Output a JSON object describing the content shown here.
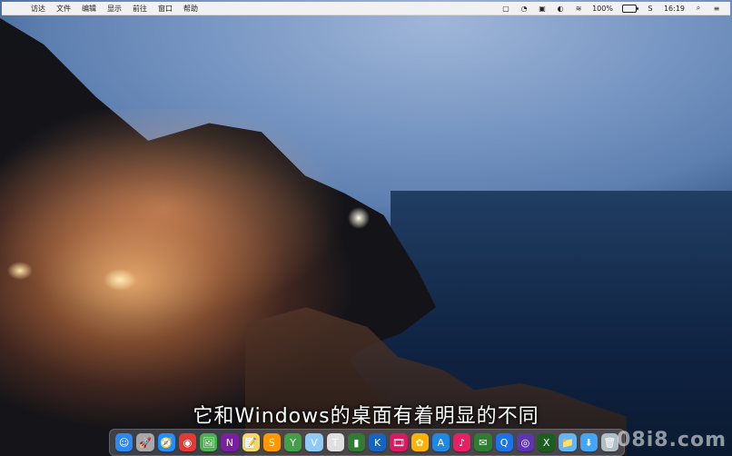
{
  "menubar": {
    "apple": "",
    "items": [
      "访达",
      "文件",
      "编辑",
      "显示",
      "前往",
      "窗口",
      "帮助"
    ],
    "status": {
      "battery": "100%",
      "time": "16:19"
    }
  },
  "subtitle": "它和Windows的桌面有着明显的不同",
  "dock": {
    "items": [
      {
        "name": "finder-icon",
        "color": "#2d89ef",
        "glyph": "☺"
      },
      {
        "name": "launchpad-icon",
        "color": "#a8a8a8",
        "glyph": "🚀"
      },
      {
        "name": "safari-icon",
        "color": "#1e90ff",
        "glyph": "🧭"
      },
      {
        "name": "chrome-icon",
        "color": "#e53935",
        "glyph": "◉"
      },
      {
        "name": "preview-icon",
        "color": "#4caf50",
        "glyph": "🖼"
      },
      {
        "name": "onenote-icon",
        "color": "#7b1fa2",
        "glyph": "N"
      },
      {
        "name": "notes-icon",
        "color": "#f6d860",
        "glyph": "📝"
      },
      {
        "name": "sublime-icon",
        "color": "#ff9800",
        "glyph": "S"
      },
      {
        "name": "y-icon",
        "color": "#43a047",
        "glyph": "Y"
      },
      {
        "name": "vpn-icon",
        "color": "#90caf9",
        "glyph": "V"
      },
      {
        "name": "textedit-icon",
        "color": "#e0e0e0",
        "glyph": "T"
      },
      {
        "name": "numbers-icon",
        "color": "#2e7d32",
        "glyph": "▮"
      },
      {
        "name": "keynote-icon",
        "color": "#1565c0",
        "glyph": "K"
      },
      {
        "name": "photobooth-icon",
        "color": "#d81b60",
        "glyph": "🎞"
      },
      {
        "name": "photos-icon",
        "color": "#ffb300",
        "glyph": "✿"
      },
      {
        "name": "appstore-icon",
        "color": "#1e88e5",
        "glyph": "A"
      },
      {
        "name": "itunes-icon",
        "color": "#e91e63",
        "glyph": "♪"
      },
      {
        "name": "wechat-icon",
        "color": "#2e7d32",
        "glyph": "✉"
      },
      {
        "name": "qq-icon",
        "color": "#1a73e8",
        "glyph": "Q"
      },
      {
        "name": "browser-icon",
        "color": "#5e35b1",
        "glyph": "◎"
      },
      {
        "name": "excel-icon",
        "color": "#1b5e20",
        "glyph": "X"
      },
      {
        "name": "folder-icon",
        "color": "#64b5f6",
        "glyph": "📁"
      },
      {
        "name": "downloads-icon",
        "color": "#42a5f5",
        "glyph": "⬇"
      },
      {
        "name": "trash-icon",
        "color": "#b0bec5",
        "glyph": "🗑"
      }
    ]
  },
  "watermark": "08i8.com"
}
